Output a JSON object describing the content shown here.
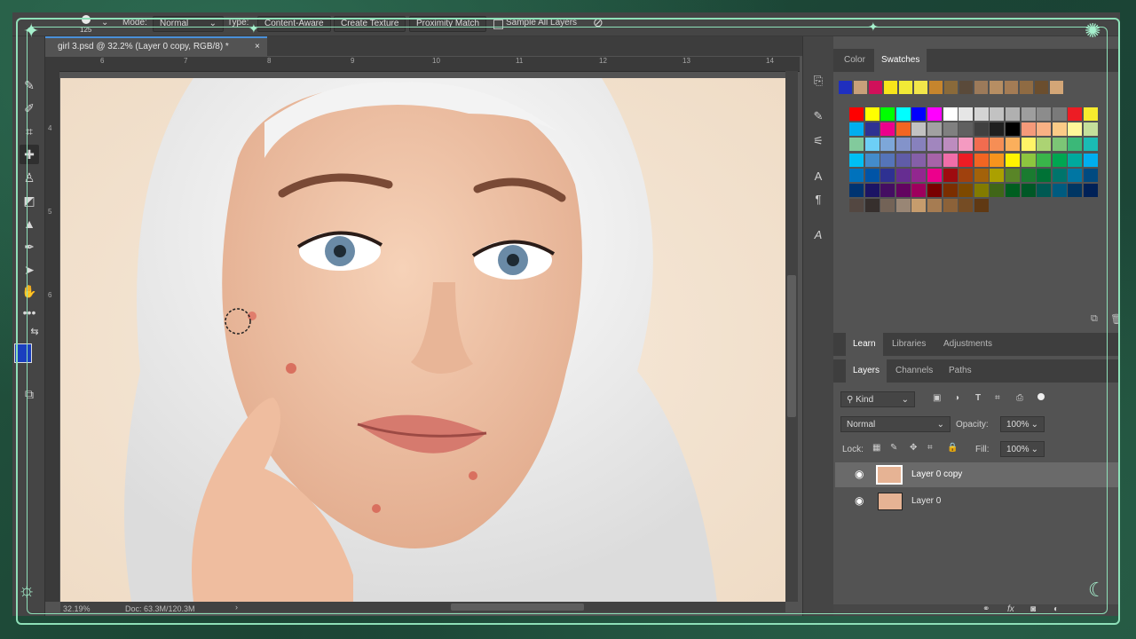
{
  "options_bar": {
    "brush_size": "125",
    "mode_label": "Mode:",
    "mode_value": "Normal",
    "type_label": "Type:",
    "type_buttons": [
      "Content-Aware",
      "Create Texture",
      "Proximity Match"
    ],
    "sample_all_layers": "Sample All Layers"
  },
  "document": {
    "tab_title": "girl 3.psd @ 32.2% (Layer 0 copy, RGB/8) *",
    "zoom": "32.19%",
    "doc_info": "Doc: 63.3M/120.3M",
    "ruler_h": [
      "6",
      "7",
      "8",
      "9",
      "10",
      "11",
      "12",
      "13",
      "14",
      "15"
    ],
    "ruler_v": [
      "4",
      "5",
      "6"
    ]
  },
  "swatches_panel": {
    "tabs": [
      "Color",
      "Swatches"
    ],
    "active_tab": "Swatches",
    "recent": [
      "#1f2fbf",
      "#c8a07a",
      "#d0105a",
      "#f7e51a",
      "#f1ea36",
      "#f2e64a",
      "#c6852d",
      "#8a6a3a",
      "#5a4a3a",
      "#9c7a5a",
      "#b68e63",
      "#a47c55",
      "#8f6b43",
      "#6b4e2e",
      "#d3a677"
    ],
    "grid": [
      [
        "#ff0000",
        "#ffff00",
        "#00ff00",
        "#00ffff",
        "#0000ff",
        "#ff00ff",
        "#ffffff",
        "#e6e6e6",
        "#d4d4d4",
        "#c2c2c2",
        "#b0b0b0",
        "#9e9e9e",
        "#8c8c8c",
        "#7a7a7a",
        "#ed1c24",
        "#f7ec2d"
      ],
      [
        "#00aeef",
        "#2e3192",
        "#ec008c",
        "#f26522",
        "#c2c2c2",
        "#a1a1a1",
        "#808080",
        "#606060",
        "#404040",
        "#202020",
        "#000000",
        "#f59a7a",
        "#f9b184",
        "#fbcb87",
        "#fff799",
        "#c4df9b"
      ],
      [
        "#82ca9c",
        "#6dcff6",
        "#7da7d9",
        "#8393ca",
        "#8781bd",
        "#a186be",
        "#bd8cbf",
        "#f49ac1",
        "#f26c4f",
        "#f68e55",
        "#fbaf5c",
        "#fff467",
        "#acd373",
        "#7cc576",
        "#3bb878",
        "#1abbb4"
      ],
      [
        "#00bff3",
        "#438ccb",
        "#5574b9",
        "#605ca8",
        "#855fa8",
        "#a763a8",
        "#f06ea9",
        "#ed1c24",
        "#f26522",
        "#f7941d",
        "#fff200",
        "#8dc63f",
        "#39b54a",
        "#00a651",
        "#00a99d",
        "#00aeef"
      ],
      [
        "#0072bc",
        "#0054a6",
        "#2e3192",
        "#662d91",
        "#92278f",
        "#ec008c",
        "#9e0b0f",
        "#a0410d",
        "#a3620a",
        "#aba000",
        "#598527",
        "#1a7b30",
        "#007236",
        "#00746b",
        "#0076a3",
        "#004a80"
      ],
      [
        "#003471",
        "#1b1464",
        "#440e62",
        "#630460",
        "#9e005d",
        "#790000",
        "#7b2e00",
        "#7d4900",
        "#827b00",
        "#406618",
        "#005e20",
        "#005826",
        "#005952",
        "#005b7f",
        "#003663",
        "#002157"
      ],
      [
        "#534741",
        "#362f2d",
        "#736357",
        "#998675",
        "#c69c6d",
        "#a67c52",
        "#8c6239",
        "#754c24",
        "#603913"
      ]
    ]
  },
  "learn_tabs": [
    "Learn",
    "Libraries",
    "Adjustments"
  ],
  "layers_panel": {
    "tabs": [
      "Layers",
      "Channels",
      "Paths"
    ],
    "kind_label": "Kind",
    "blend_mode": "Normal",
    "opacity_label": "Opacity:",
    "opacity_value": "100%",
    "lock_label": "Lock:",
    "fill_label": "Fill:",
    "fill_value": "100%",
    "layers": [
      {
        "name": "Layer 0 copy",
        "visible": true,
        "selected": true
      },
      {
        "name": "Layer 0",
        "visible": true,
        "selected": false
      }
    ]
  },
  "tools": [
    "brush-icon",
    "healing-brush-icon",
    "crop-icon",
    "spot-healing-icon",
    "clone-stamp-icon",
    "eraser-icon",
    "gradient-icon",
    "pen-icon",
    "path-select-icon",
    "hand-icon",
    "more-tools-icon"
  ],
  "colors": {
    "foreground": "#1a3fbf",
    "accent": "#4a90d9",
    "frame": "#8ee0b8"
  }
}
